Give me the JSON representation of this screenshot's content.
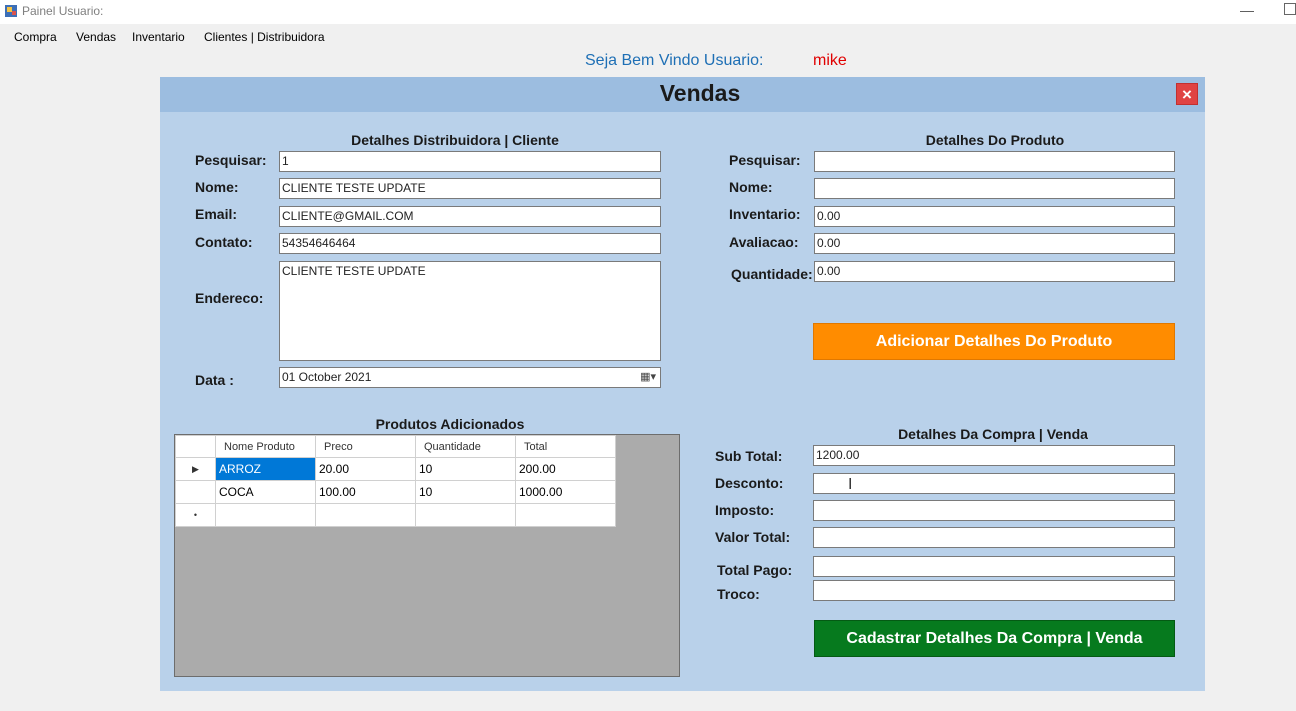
{
  "window": {
    "title": "Painel Usuario:"
  },
  "menu": [
    "Compra",
    "Vendas",
    "Inventario",
    "Clientes | Distribuidora"
  ],
  "welcome": {
    "label": "Seja Bem Vindo Usuario:",
    "user": "mike"
  },
  "panel": {
    "title": "Vendas",
    "close_label": "×"
  },
  "customer": {
    "section_title": "Detalhes Distribuidora | Cliente",
    "search_label": "Pesquisar:",
    "search_value": "1",
    "name_label": "Nome:",
    "name_value": "CLIENTE TESTE UPDATE",
    "email_label": "Email:",
    "email_value": "CLIENTE@GMAIL.COM",
    "contact_label": "Contato:",
    "contact_value": "54354646464",
    "address_label": "Endereco:",
    "address_value": "CLIENTE TESTE UPDATE",
    "date_label": "Data :",
    "date_value": "01  October   2021"
  },
  "product": {
    "section_title": "Detalhes Do Produto",
    "search_label": "Pesquisar:",
    "search_value": "",
    "name_label": "Nome:",
    "name_value": "",
    "inventory_label": "Inventario:",
    "inventory_value": "0.00",
    "rating_label": "Avaliacao:",
    "rating_value": "0.00",
    "qty_label": "Quantidade:",
    "qty_value": "0.00",
    "add_button": "Adicionar Detalhes Do Produto"
  },
  "added": {
    "section_title": "Produtos Adicionados",
    "columns": [
      "Nome Produto",
      "Preco",
      "Quantidade",
      "Total"
    ],
    "rows": [
      [
        "ARROZ",
        "20.00",
        "10",
        "200.00"
      ],
      [
        "COCA",
        "100.00",
        "10",
        "1000.00"
      ]
    ],
    "current_row_marker": "▶",
    "new_row_marker": "•"
  },
  "sale": {
    "section_title": "Detalhes Da Compra | Venda",
    "subtotal_label": "Sub Total:",
    "subtotal_value": "1200.00",
    "discount_label": "Desconto:",
    "discount_value": "",
    "tax_label": "Imposto:",
    "tax_value": "",
    "total_label": "Valor Total:",
    "total_value": "",
    "paid_label": "Total Pago:",
    "paid_value": "",
    "change_label": "Troco:",
    "change_value": "",
    "save_button": "Cadastrar Detalhes Da Compra | Venda"
  },
  "colors": {
    "panel_bg": "#b9d1ea",
    "orange_button": "#ff8c00",
    "green_button": "#067a1e",
    "welcome_text": "#1e6fb5",
    "username_text": "#e00000",
    "close_button": "#e04343"
  }
}
